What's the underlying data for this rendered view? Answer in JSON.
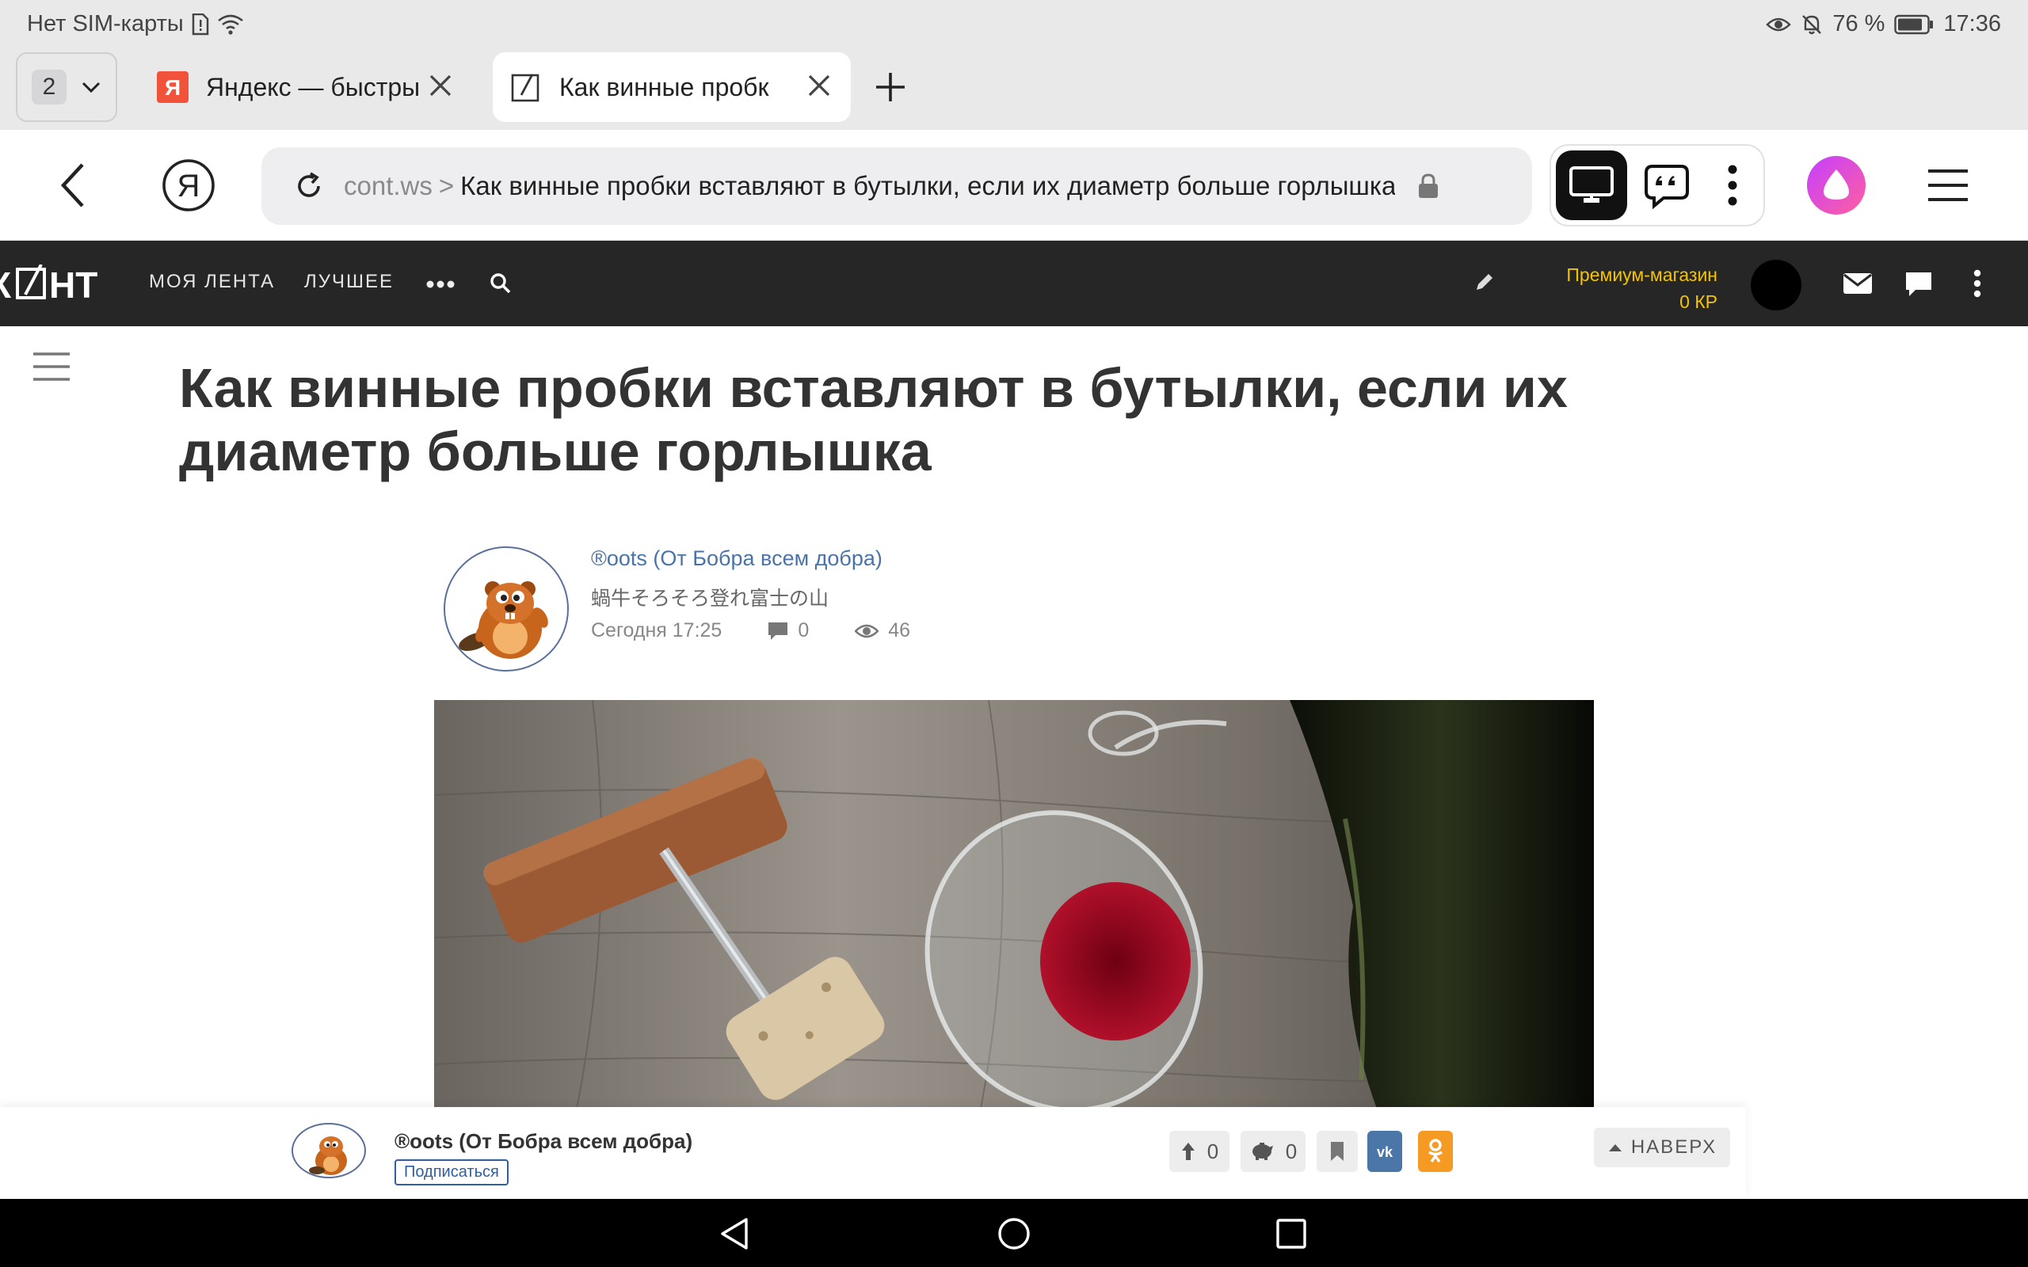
{
  "status_bar": {
    "carrier": "Нет SIM-карты",
    "battery": "76 %",
    "time": "17:36"
  },
  "tabs": {
    "count": "2",
    "items": [
      {
        "title": "Яндекс — быстрый",
        "favicon": "Я",
        "active": false
      },
      {
        "title": "Как винные пробки",
        "active": true
      }
    ]
  },
  "address_bar": {
    "host": "cont.ws",
    "separator": ">",
    "path": "Как винные пробки вставляют в бутылки, если их диаметр больше горлышка"
  },
  "site_header": {
    "logo": "КОНТ",
    "nav": [
      "МОЯ ЛЕНТА",
      "ЛУЧШЕЕ"
    ],
    "premium_label": "Премиум-магазин",
    "premium_balance": "0 КР"
  },
  "article": {
    "title": "Как винные пробки вставляют в бутылки, если их диаметр больше горлышка",
    "author_name": "®oots (От Бобра всем добра)",
    "author_motto": "蝸牛そろそろ登れ富士の山",
    "date": "Сегодня 17:25",
    "comments": "0",
    "views": "46"
  },
  "sticky_bar": {
    "author_name": "®oots (От Бобра всем добра)",
    "subscribe_label": "Подписаться",
    "upvotes": "0",
    "donations": "0",
    "back_to_top": "НАВЕРХ"
  },
  "colors": {
    "header_bg": "#262626",
    "premium_accent": "#f5c400",
    "link_blue": "#4a74a8",
    "vk": "#4a76a8",
    "ok": "#f59a23"
  }
}
